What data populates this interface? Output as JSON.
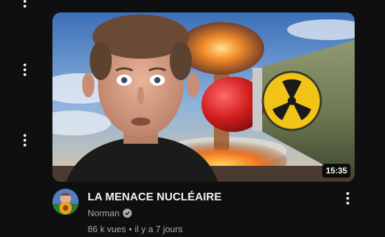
{
  "video": {
    "title": "LA MENACE NUCLÉAIRE",
    "channel": "Norman",
    "views": "86 k vues",
    "separator": "•",
    "age": "il y a 7 jours",
    "duration": "15:35"
  },
  "icons": {
    "more": "more-vert-icon",
    "verified": "verified-check-icon",
    "radiation": "radiation-icon"
  },
  "colors": {
    "background": "#0f0f0f",
    "title": "#f1f1f1",
    "secondary": "#aaaaaa",
    "missile_tip": "#d32222",
    "radiation_yellow": "#f2c418"
  }
}
